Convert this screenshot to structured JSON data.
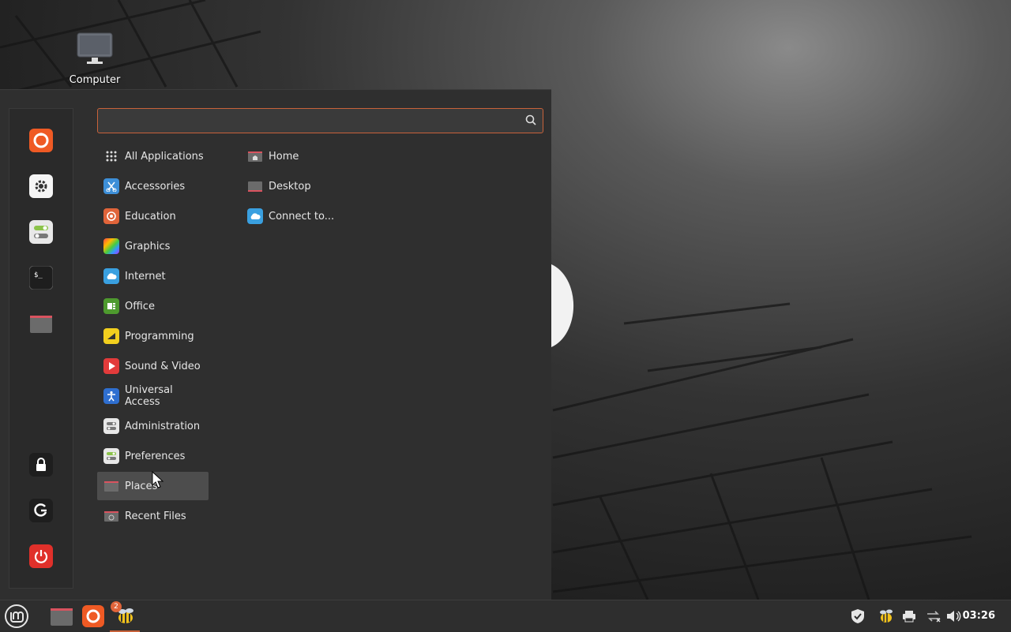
{
  "desktop": {
    "computer_label": "Computer"
  },
  "menu": {
    "search": {
      "value": "",
      "placeholder": ""
    },
    "categories": [
      {
        "label": "All Applications",
        "icon": "grid-icon"
      },
      {
        "label": "Accessories",
        "icon": "scissors-icon"
      },
      {
        "label": "Education",
        "icon": "education-icon"
      },
      {
        "label": "Graphics",
        "icon": "graphics-icon"
      },
      {
        "label": "Internet",
        "icon": "cloud-icon"
      },
      {
        "label": "Office",
        "icon": "office-icon"
      },
      {
        "label": "Programming",
        "icon": "programming-icon"
      },
      {
        "label": "Sound & Video",
        "icon": "play-icon"
      },
      {
        "label": "Universal Access",
        "icon": "accessibility-icon"
      },
      {
        "label": "Administration",
        "icon": "toggles-icon"
      },
      {
        "label": "Preferences",
        "icon": "toggles-green-icon"
      },
      {
        "label": "Places",
        "icon": "folder-icon",
        "selected": true
      },
      {
        "label": "Recent Files",
        "icon": "recent-folder-icon"
      }
    ],
    "places": [
      {
        "label": "Home",
        "icon": "home-folder-icon"
      },
      {
        "label": "Desktop",
        "icon": "desktop-folder-icon"
      },
      {
        "label": "Connect to...",
        "icon": "cloud-icon"
      }
    ],
    "favorites": [
      "firefox-icon",
      "settings-icon",
      "software-manager-icon",
      "terminal-icon",
      "files-icon"
    ],
    "session": [
      "lock-icon",
      "logout-icon",
      "power-icon"
    ]
  },
  "taskbar": {
    "notification_count": "2",
    "clock": "03:26"
  },
  "colors": {
    "accent": "#c8623a",
    "selected_bg": "#4d4d4d",
    "panel_bg": "#2f2f2f"
  }
}
